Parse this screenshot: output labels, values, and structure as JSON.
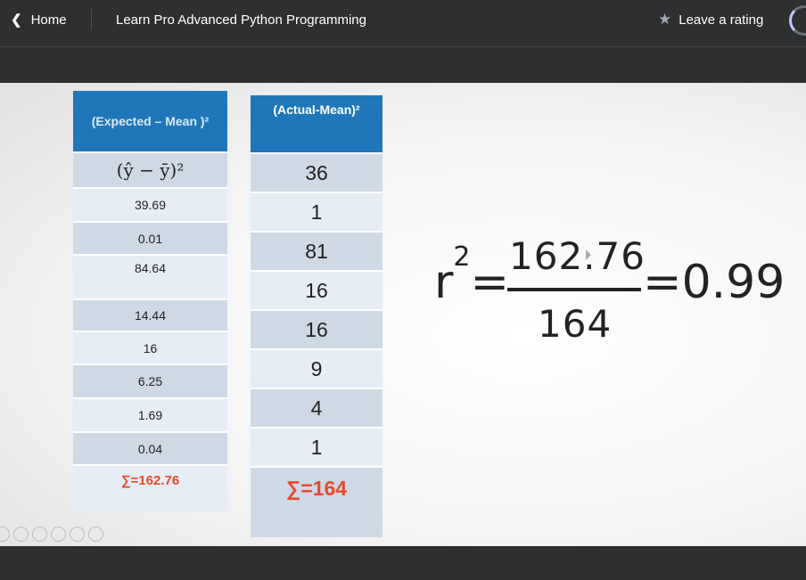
{
  "topbar": {
    "back_label": "Home",
    "course_title": "Learn Pro Advanced Python Programming",
    "rating_label": "Leave a rating"
  },
  "slide": {
    "table_expected": {
      "header": "(Expected – Mean )²",
      "formula_row": "(ŷ − ȳ)²",
      "values": [
        "39.69",
        "0.01",
        "84.64",
        "14.44",
        "16",
        "6.25",
        "1.69",
        "0.04"
      ],
      "sum": "∑=162.76"
    },
    "table_actual": {
      "header": "(Actual-Mean)²",
      "values": [
        "36",
        "1",
        "81",
        "16",
        "16",
        "9",
        "4",
        "1"
      ],
      "sum": "∑=164"
    },
    "formula": {
      "r": "r",
      "exp": "2",
      "equals": "=",
      "numerator": "162.76",
      "denominator": "164",
      "result": "=0.99"
    }
  },
  "colors": {
    "header_blue": "#1f77b9",
    "row_dark": "#cfd9e6",
    "row_light": "#e7edf5",
    "sum_red": "#e8492b",
    "topbar_bg": "#2d2f31"
  }
}
